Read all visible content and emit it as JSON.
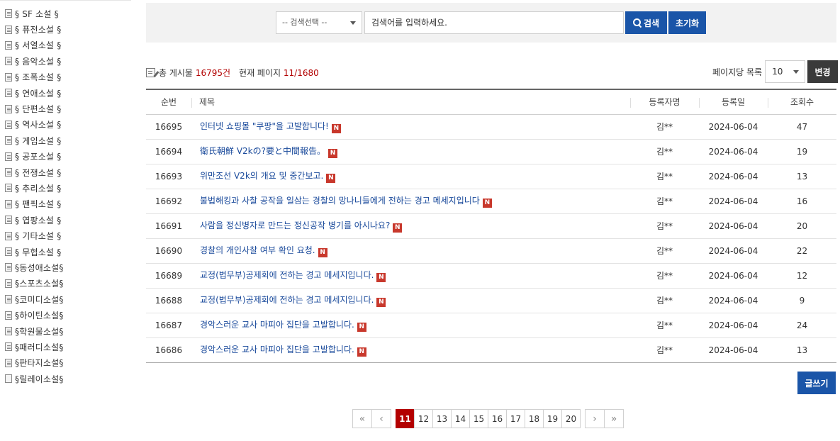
{
  "sidebar": {
    "items": [
      {
        "label": "§ SF 소설 §",
        "icon": "doc-icon"
      },
      {
        "label": "§ 퓨전소설 §",
        "icon": "doc-icon"
      },
      {
        "label": "§ 서열소설 §",
        "icon": "doc-icon"
      },
      {
        "label": "§ 음악소설 §",
        "icon": "doc-icon"
      },
      {
        "label": "§ 조폭소설 §",
        "icon": "doc-icon"
      },
      {
        "label": "§ 연애소설 §",
        "icon": "doc-icon"
      },
      {
        "label": "§ 단편소설 §",
        "icon": "doc-icon"
      },
      {
        "label": "§ 역사소설 §",
        "icon": "doc-icon"
      },
      {
        "label": "§ 게임소설 §",
        "icon": "doc-icon"
      },
      {
        "label": "§ 공포소설 §",
        "icon": "doc-icon"
      },
      {
        "label": "§ 전쟁소설 §",
        "icon": "doc-icon"
      },
      {
        "label": "§ 추리소설 §",
        "icon": "doc-icon"
      },
      {
        "label": "§ 팬픽소설 §",
        "icon": "doc-icon"
      },
      {
        "label": "§ 엽팡소설 §",
        "icon": "doc-icon"
      },
      {
        "label": "§ 기타소설 §",
        "icon": "doc-icon"
      },
      {
        "label": "§ 무협소설 §",
        "icon": "doc-icon"
      },
      {
        "label": "§동성애소설§",
        "icon": "doc-icon"
      },
      {
        "label": "§스포츠소설§",
        "icon": "doc-icon"
      },
      {
        "label": "§코미디소설§",
        "icon": "doc-icon"
      },
      {
        "label": "§하이틴소설§",
        "icon": "doc-icon"
      },
      {
        "label": "§학원물소설§",
        "icon": "doc-icon"
      },
      {
        "label": "§패러디소설§",
        "icon": "doc-icon"
      },
      {
        "label": "§판타지소설§",
        "icon": "doc-icon"
      },
      {
        "label": "§릴레이소설§",
        "icon": "doc-blank-icon"
      }
    ]
  },
  "search": {
    "select_value": "-- 검색선택 --",
    "placeholder": "검색어를 입력하세요.",
    "search_label": "검색",
    "reset_label": "초기화"
  },
  "summary": {
    "total_label": "총 게시물",
    "total_count": "16795건",
    "page_label": "현재 페이지",
    "page_value": "11/1680",
    "per_page_label": "페이지당 목록",
    "per_page_value": "10",
    "change_label": "변경"
  },
  "table": {
    "headers": {
      "no": "순번",
      "title": "제목",
      "writer": "등록자명",
      "date": "등록일",
      "views": "조회수"
    },
    "new_badge": "N",
    "rows": [
      {
        "no": "16695",
        "title": "인터넷 쇼핑몰 \"쿠팡\"을 고발합니다!",
        "writer": "김**",
        "date": "2024-06-04",
        "views": "47"
      },
      {
        "no": "16694",
        "title": "衛氏朝鮮 V2kの?要と中間報告。",
        "writer": "김**",
        "date": "2024-06-04",
        "views": "19"
      },
      {
        "no": "16693",
        "title": "위만조선 V2k의 개요 및 중간보고.",
        "writer": "김**",
        "date": "2024-06-04",
        "views": "13"
      },
      {
        "no": "16692",
        "title": "불법해킹과 사찰 공작을 일삼는 경찰의 망나니들에게 전하는 경고 메세지입니다",
        "writer": "김**",
        "date": "2024-06-04",
        "views": "16"
      },
      {
        "no": "16691",
        "title": "사람을 정신병자로 만드는 정신공작 병기를 아시나요?",
        "writer": "김**",
        "date": "2024-06-04",
        "views": "20"
      },
      {
        "no": "16690",
        "title": "경찰의 개인사찰 여부 확인 요청.",
        "writer": "김**",
        "date": "2024-06-04",
        "views": "22"
      },
      {
        "no": "16689",
        "title": "교정(법무부)공제회에 전하는 경고 메세지입니다.",
        "writer": "김**",
        "date": "2024-06-04",
        "views": "12"
      },
      {
        "no": "16688",
        "title": "교정(법무부)공제회에 전하는 경고 메세지입니다.",
        "writer": "김**",
        "date": "2024-06-04",
        "views": "9"
      },
      {
        "no": "16687",
        "title": "경악스러운 교사 마피아 집단을 고발합니다.",
        "writer": "김**",
        "date": "2024-06-04",
        "views": "24"
      },
      {
        "no": "16686",
        "title": "경악스러운 교사 마피아 집단을 고발합니다.",
        "writer": "김**",
        "date": "2024-06-04",
        "views": "13"
      }
    ]
  },
  "write_label": "글쓰기",
  "pagination": {
    "first": "«",
    "prev": "‹",
    "next": "›",
    "last": "»",
    "pages": [
      "11",
      "12",
      "13",
      "14",
      "15",
      "16",
      "17",
      "18",
      "19",
      "20"
    ],
    "current": "11"
  },
  "colors": {
    "primary": "#1a55a8",
    "active_page": "#b30000",
    "new_badge": "#c8382c",
    "count_red": "#b20000"
  }
}
